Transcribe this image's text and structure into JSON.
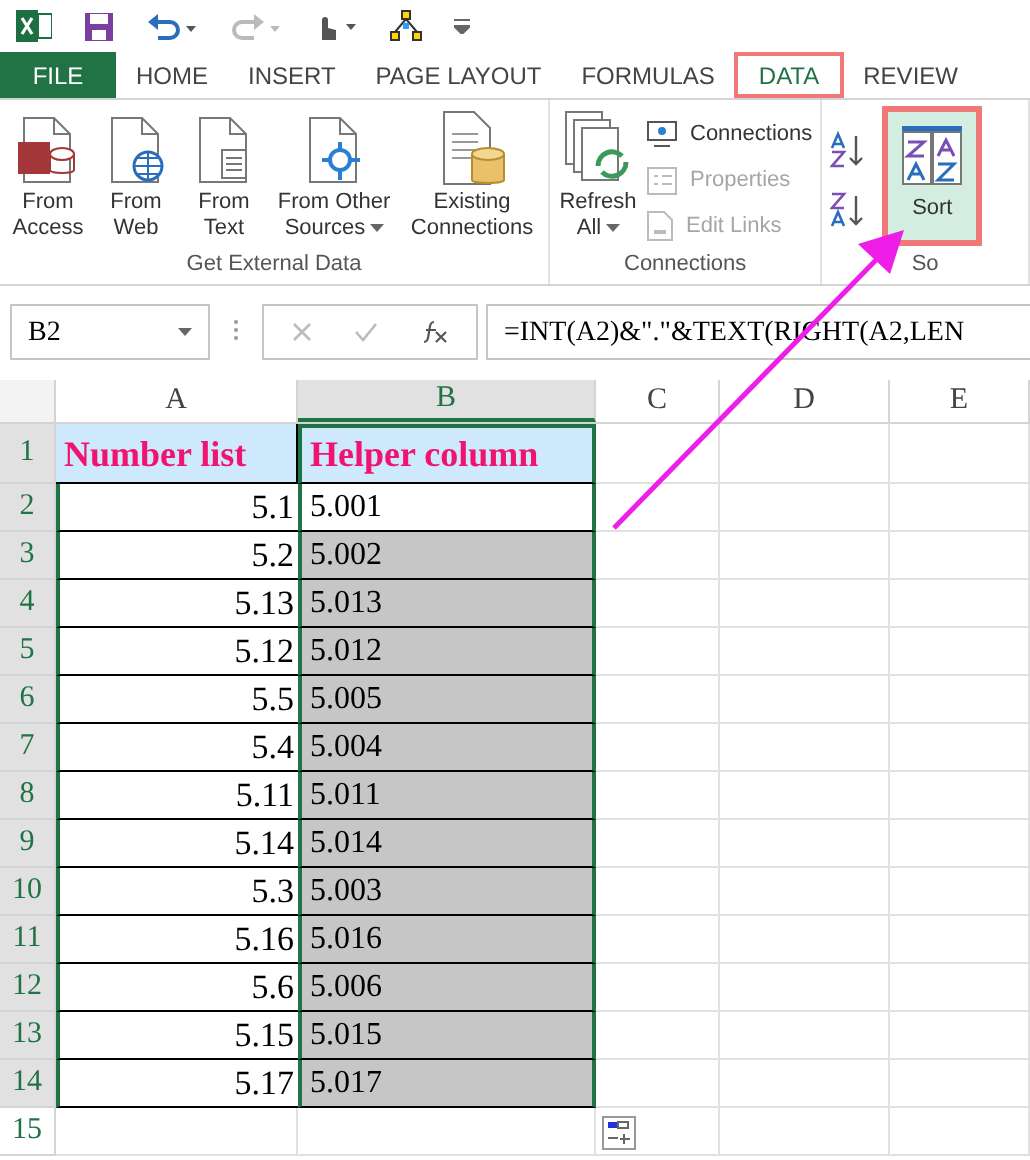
{
  "tabs": [
    {
      "label": "FILE",
      "kind": "file",
      "selected": false,
      "highlighted": false
    },
    {
      "label": "HOME",
      "kind": "tab",
      "selected": false,
      "highlighted": false
    },
    {
      "label": "INSERT",
      "kind": "tab",
      "selected": false,
      "highlighted": false
    },
    {
      "label": "PAGE LAYOUT",
      "kind": "tab",
      "selected": false,
      "highlighted": false
    },
    {
      "label": "FORMULAS",
      "kind": "tab",
      "selected": false,
      "highlighted": false
    },
    {
      "label": "DATA",
      "kind": "tab",
      "selected": true,
      "highlighted": true
    },
    {
      "label": "REVIEW",
      "kind": "tab",
      "selected": false,
      "highlighted": false
    }
  ],
  "ribbon": {
    "groups": [
      {
        "label": "Get External Data",
        "buttons": [
          {
            "kind": "access",
            "label": "From Access",
            "dropdown": false
          },
          {
            "kind": "web",
            "label": "From Web",
            "dropdown": false
          },
          {
            "kind": "text",
            "label": "From Text",
            "dropdown": false
          },
          {
            "kind": "other",
            "label": "From Other Sources",
            "dropdown": true
          },
          {
            "kind": "existing",
            "label": "Existing Connections",
            "dropdown": false
          }
        ]
      },
      {
        "label": "Connections",
        "buttons": [
          {
            "kind": "refresh",
            "label": "Refresh All",
            "dropdown": true
          }
        ],
        "small_items": [
          {
            "kind": "connections",
            "label": "Connections",
            "disabled": false
          },
          {
            "kind": "properties",
            "label": "Properties",
            "disabled": true
          },
          {
            "kind": "links",
            "label": "Edit Links",
            "disabled": true
          }
        ]
      },
      {
        "label": "So",
        "buttons": [
          {
            "kind": "sort",
            "label": "Sort",
            "dropdown": false,
            "highlighted": true
          }
        ],
        "small_items": [
          {
            "kind": "sort-az"
          },
          {
            "kind": "sort-za"
          }
        ]
      }
    ]
  },
  "formula_bar": {
    "name_box": "B2",
    "formula": "=INT(A2)&\".\"&TEXT(RIGHT(A2,LEN"
  },
  "columns": [
    {
      "label": "A",
      "selected": false
    },
    {
      "label": "B",
      "selected": true
    },
    {
      "label": "C",
      "selected": false
    },
    {
      "label": "D",
      "selected": false
    },
    {
      "label": "E",
      "selected": false
    }
  ],
  "rows": [
    {
      "number": "1",
      "kind": "header",
      "cells": [
        "Number list",
        "Helper column"
      ]
    },
    {
      "number": "2",
      "kind": "data",
      "cells": [
        "5.1",
        "5.001"
      ],
      "selected": false
    },
    {
      "number": "3",
      "kind": "data",
      "cells": [
        "5.2",
        "5.002"
      ],
      "selected": true
    },
    {
      "number": "4",
      "kind": "data",
      "cells": [
        "5.13",
        "5.013"
      ],
      "selected": true
    },
    {
      "number": "5",
      "kind": "data",
      "cells": [
        "5.12",
        "5.012"
      ],
      "selected": true
    },
    {
      "number": "6",
      "kind": "data",
      "cells": [
        "5.5",
        "5.005"
      ],
      "selected": true
    },
    {
      "number": "7",
      "kind": "data",
      "cells": [
        "5.4",
        "5.004"
      ],
      "selected": true
    },
    {
      "number": "8",
      "kind": "data",
      "cells": [
        "5.11",
        "5.011"
      ],
      "selected": true
    },
    {
      "number": "9",
      "kind": "data",
      "cells": [
        "5.14",
        "5.014"
      ],
      "selected": true
    },
    {
      "number": "10",
      "kind": "data",
      "cells": [
        "5.3",
        "5.003"
      ],
      "selected": true
    },
    {
      "number": "11",
      "kind": "data",
      "cells": [
        "5.16",
        "5.016"
      ],
      "selected": true
    },
    {
      "number": "12",
      "kind": "data",
      "cells": [
        "5.6",
        "5.006"
      ],
      "selected": true
    },
    {
      "number": "13",
      "kind": "data",
      "cells": [
        "5.15",
        "5.015"
      ],
      "selected": true
    },
    {
      "number": "14",
      "kind": "data",
      "cells": [
        "5.17",
        "5.017"
      ],
      "selected": true
    },
    {
      "number": "15",
      "kind": "empty"
    }
  ]
}
